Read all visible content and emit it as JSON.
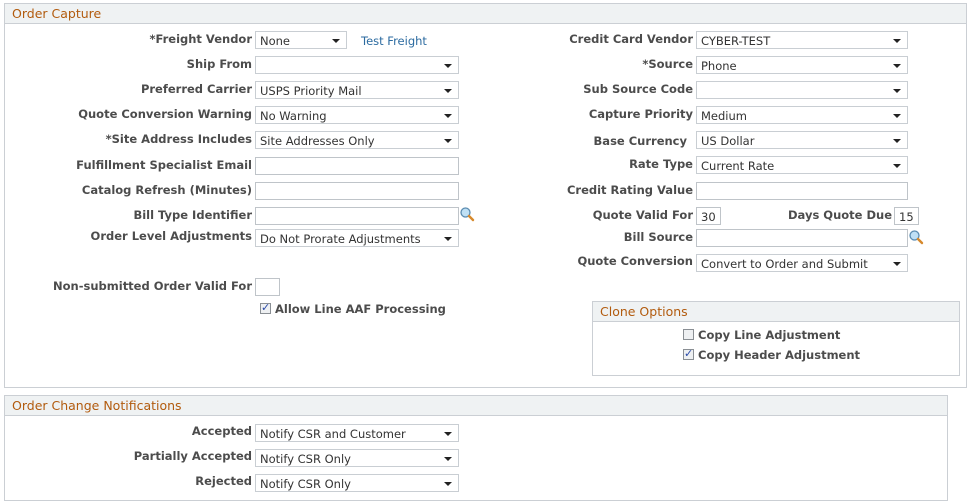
{
  "order_capture": {
    "title": "Order Capture",
    "left": {
      "freight_vendor": {
        "label": "*Freight Vendor",
        "value": "None",
        "link": "Test Freight"
      },
      "ship_from": {
        "label": "Ship From",
        "value": ""
      },
      "preferred_carrier": {
        "label": "Preferred Carrier",
        "value": "USPS Priority Mail"
      },
      "quote_conversion_warning": {
        "label": "Quote Conversion Warning",
        "value": "No Warning"
      },
      "site_address_includes": {
        "label": "*Site Address Includes",
        "value": "Site Addresses Only"
      },
      "fulfillment_specialist_email": {
        "label": "Fulfillment Specialist Email",
        "value": ""
      },
      "catalog_refresh": {
        "label": "Catalog Refresh (Minutes)",
        "value": ""
      },
      "bill_type_identifier": {
        "label": "Bill Type Identifier",
        "value": ""
      },
      "order_level_adjustments": {
        "label": "Order Level Adjustments",
        "value": "Do Not Prorate Adjustments"
      },
      "non_submitted_order_valid_for": {
        "label": "Non-submitted Order Valid For",
        "value": ""
      },
      "allow_line_aaf": {
        "label": "Allow Line AAF Processing",
        "checked": true
      }
    },
    "right": {
      "credit_card_vendor": {
        "label": "Credit Card Vendor",
        "value": "CYBER-TEST"
      },
      "source": {
        "label": "*Source",
        "value": "Phone"
      },
      "sub_source_code": {
        "label": "Sub Source Code",
        "value": ""
      },
      "capture_priority": {
        "label": "Capture Priority",
        "value": "Medium"
      },
      "base_currency": {
        "label": "Base Currency",
        "value": "US Dollar"
      },
      "rate_type": {
        "label": "Rate Type",
        "value": "Current Rate"
      },
      "credit_rating_value": {
        "label": "Credit Rating Value",
        "value": ""
      },
      "quote_valid_for": {
        "label": "Quote Valid For",
        "value": "30"
      },
      "days_quote_due": {
        "label": "Days Quote Due",
        "value": "15"
      },
      "bill_source": {
        "label": "Bill Source",
        "value": ""
      },
      "quote_conversion": {
        "label": "Quote Conversion",
        "value": "Convert to Order and Submit"
      }
    },
    "clone_options": {
      "title": "Clone Options",
      "copy_line_adjustment": {
        "label": "Copy Line Adjustment",
        "checked": false
      },
      "copy_header_adjustment": {
        "label": "Copy Header Adjustment",
        "checked": true
      }
    }
  },
  "order_change_notifications": {
    "title": "Order Change Notifications",
    "accepted": {
      "label": "Accepted",
      "value": "Notify CSR and Customer"
    },
    "partially_accepted": {
      "label": "Partially Accepted",
      "value": "Notify CSR Only"
    },
    "rejected": {
      "label": "Rejected",
      "value": "Notify CSR Only"
    }
  },
  "colors": {
    "group_title": "#b25b0e",
    "link": "#2c6ba0",
    "header_bg": "#eff2f3",
    "border": "#cbcfd4"
  }
}
